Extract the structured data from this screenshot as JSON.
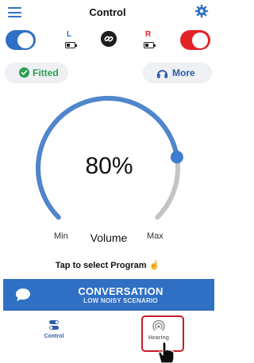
{
  "header": {
    "title": "Control",
    "menu_icon": "hamburger-menu-icon",
    "settings_icon": "gear-icon"
  },
  "devices": {
    "left": {
      "label": "L",
      "enabled": true,
      "color": "#2f6fc4"
    },
    "right": {
      "label": "R",
      "enabled": true,
      "color": "#e32227"
    },
    "link_icon": "link-icon"
  },
  "actions": {
    "fitted_label": "Fitted",
    "more_label": "More"
  },
  "volume": {
    "value_text": "80%",
    "level": 0.8,
    "label": "Volume",
    "min_label": "Min",
    "max_label": "Max"
  },
  "program": {
    "tap_label": "Tap to select Program",
    "name": "CONVERSATION",
    "subtitle": "LOW NOISY SCENARIO"
  },
  "tabs": [
    {
      "label": "Control",
      "active": true
    },
    {
      "label": "Hearing",
      "active": false
    }
  ],
  "colors": {
    "accent": "#2f6fc4",
    "right_ear": "#e32227",
    "fitted_green": "#2e9e53",
    "highlight": "#c91a2a"
  }
}
